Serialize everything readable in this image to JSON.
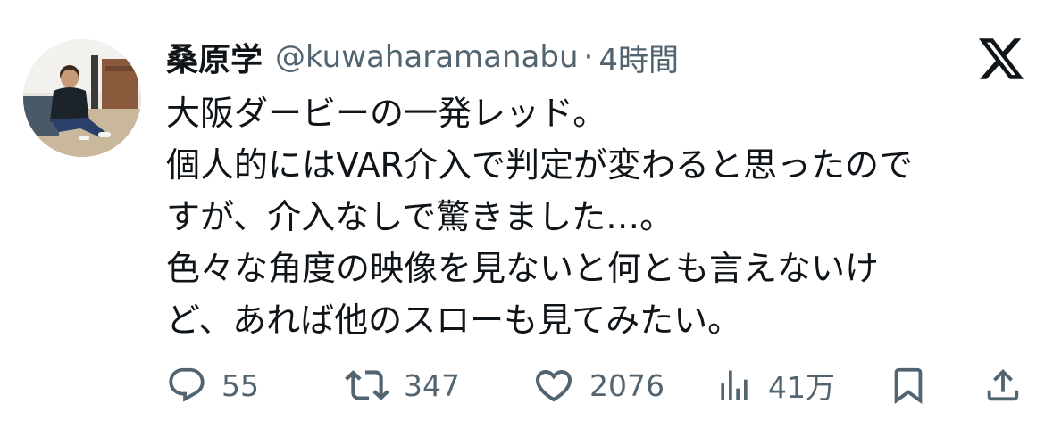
{
  "author": {
    "display_name": "桑原学",
    "handle": "@kuwaharamanabu",
    "separator": "·",
    "time": "4時間"
  },
  "brand": {
    "logo_icon": "x-logo-icon",
    "text_color": "#0f1419",
    "muted_color": "#536471"
  },
  "tweet": {
    "lines": [
      "大阪ダービーの一発レッド。",
      "個人的にはVAR介入で判定が変わると思ったので",
      "すが、介入なしで驚きました…。",
      "色々な角度の映像を見ないと何とも言えないけ",
      "ど、あれば他のスローも見てみたい。"
    ]
  },
  "actions": {
    "reply": {
      "icon": "reply-icon",
      "count": "55"
    },
    "retweet": {
      "icon": "retweet-icon",
      "count": "347"
    },
    "like": {
      "icon": "heart-icon",
      "count": "2076"
    },
    "views": {
      "icon": "views-icon",
      "count": "41万"
    },
    "bookmark": {
      "icon": "bookmark-icon"
    },
    "share": {
      "icon": "share-icon"
    }
  }
}
